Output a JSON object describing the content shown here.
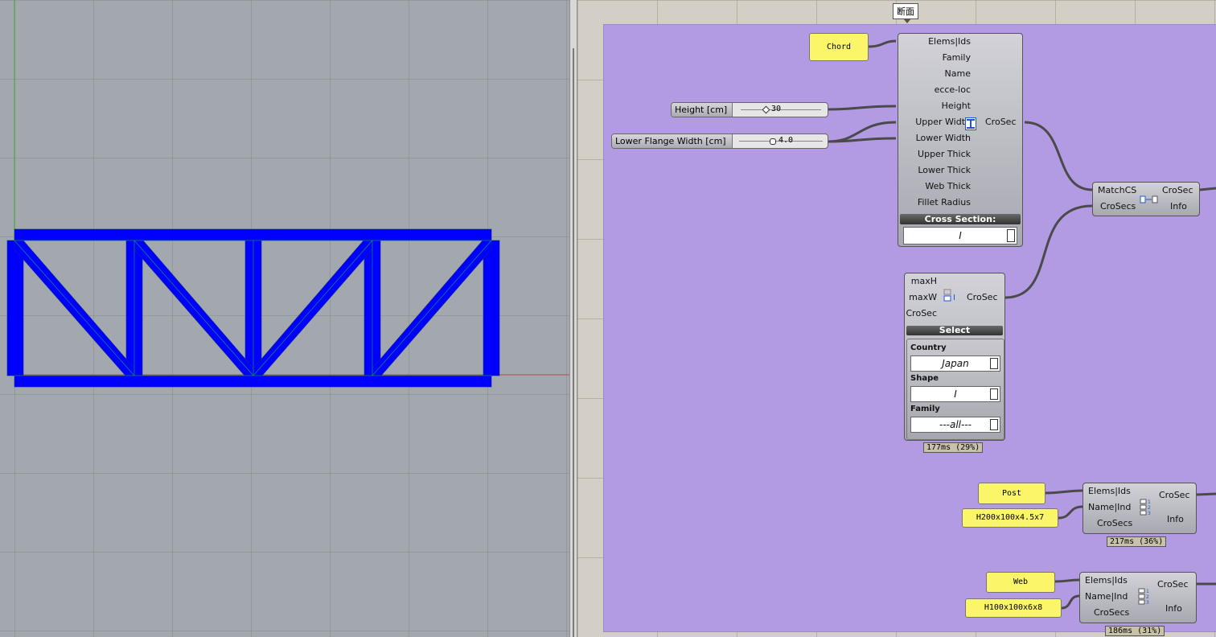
{
  "canvas": {
    "group_tag": "断面"
  },
  "panels": {
    "chord": "Chord",
    "post": "Post",
    "post_section": "H200x100x4.5x7",
    "web": "Web",
    "web_section": "H100x100x6x8"
  },
  "sliders": {
    "height_label": "Height [cm]",
    "height_value": "30",
    "lower_flange_label": "Lower Flange Width [cm]",
    "lower_flange_value": "4.0"
  },
  "crosec_component": {
    "inputs": [
      "Elems|Ids",
      "Family",
      "Name",
      "ecce-loc",
      "Height",
      "Upper Width",
      "Lower Width",
      "Upper Thick",
      "Lower Thick",
      "Web Thick",
      "Fillet Radius"
    ],
    "output": "CroSec",
    "menu_title": "Cross Section:",
    "selected_shape": "I"
  },
  "select_component": {
    "inputs": [
      "maxH",
      "maxW",
      "CroSec"
    ],
    "output": "CroSec",
    "menu_title": "Select",
    "country_label": "Country",
    "country_value": "Japan",
    "shape_label": "Shape",
    "shape_value": "I",
    "family_label": "Family",
    "family_value": "---all---",
    "timing": "177ms (29%)"
  },
  "match_component": {
    "inputs": [
      "MatchCS",
      "CroSecs"
    ],
    "outputs": [
      "CroSec",
      "Info"
    ]
  },
  "post_component": {
    "inputs": [
      "Elems|Ids",
      "Name|Ind",
      "CroSecs"
    ],
    "outputs": [
      "CroSec",
      "Info"
    ],
    "timing": "217ms (36%)"
  },
  "web_component": {
    "inputs": [
      "Elems|Ids",
      "Name|Ind",
      "CroSecs"
    ],
    "outputs": [
      "CroSec",
      "Info"
    ],
    "timing": "186ms (31%)"
  },
  "colors": {
    "truss": "#0000ff",
    "group": "#b39be4",
    "panel": "#fbf56a"
  }
}
